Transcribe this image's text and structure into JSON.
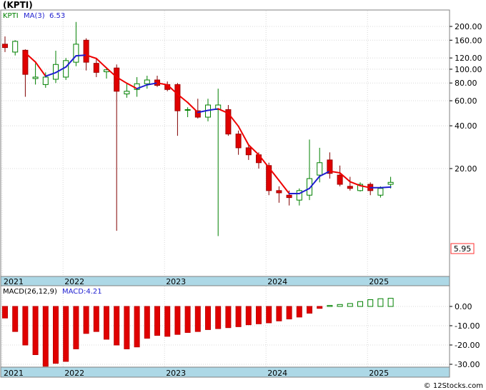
{
  "header": {
    "title": "(KPTI)"
  },
  "price_panel": {
    "ticker": "KPTI",
    "ma_label": "MA(3)",
    "ma_value": "6.53",
    "last_price": "5.95"
  },
  "macd_panel": {
    "label": "MACD(26,12,9)",
    "value_label": "MACD:4.21"
  },
  "credit": "© 12Stocks.com",
  "colors": {
    "up": "#008000",
    "down": "#e00000",
    "ma_up": "#1f1fd0",
    "ma_down": "#ee0000",
    "axis_band": "#add8e6",
    "price_label": "#ff3030"
  },
  "chart_data": [
    {
      "type": "candlestick",
      "scale": "log",
      "interval": "monthly",
      "y_ticks": [
        {
          "value": 200,
          "label": "200.00"
        },
        {
          "value": 160,
          "label": "160.00"
        },
        {
          "value": 120,
          "label": "120.00"
        },
        {
          "value": 100,
          "label": "100.00"
        },
        {
          "value": 80,
          "label": "80.00"
        },
        {
          "value": 60,
          "label": "60.00"
        },
        {
          "value": 40,
          "label": "40.00"
        },
        {
          "value": 20,
          "label": "20.00"
        }
      ],
      "x_ticks": [
        {
          "index": 0,
          "label": "2021"
        },
        {
          "index": 6,
          "label": "2022"
        },
        {
          "index": 16,
          "label": "2023"
        },
        {
          "index": 26,
          "label": "2024"
        },
        {
          "index": 36,
          "label": "2025"
        }
      ],
      "ohlc": [
        {
          "o": 150,
          "h": 170,
          "l": 132,
          "c": 142
        },
        {
          "o": 132,
          "h": 160,
          "l": 125,
          "c": 157
        },
        {
          "o": 136,
          "h": 138,
          "l": 64,
          "c": 92
        },
        {
          "o": 86,
          "h": 110,
          "l": 78,
          "c": 88
        },
        {
          "o": 78,
          "h": 95,
          "l": 74,
          "c": 88
        },
        {
          "o": 85,
          "h": 135,
          "l": 80,
          "c": 108
        },
        {
          "o": 88,
          "h": 120,
          "l": 84,
          "c": 115
        },
        {
          "o": 112,
          "h": 215,
          "l": 105,
          "c": 150
        },
        {
          "o": 160,
          "h": 165,
          "l": 98,
          "c": 112
        },
        {
          "o": 110,
          "h": 120,
          "l": 88,
          "c": 95
        },
        {
          "o": 96,
          "h": 103,
          "l": 86,
          "c": 99
        },
        {
          "o": 102,
          "h": 108,
          "l": 7.3,
          "c": 70
        },
        {
          "o": 67,
          "h": 80,
          "l": 63,
          "c": 70
        },
        {
          "o": 72,
          "h": 88,
          "l": 64,
          "c": 79
        },
        {
          "o": 79,
          "h": 90,
          "l": 73,
          "c": 84
        },
        {
          "o": 84,
          "h": 90,
          "l": 75,
          "c": 77
        },
        {
          "o": 78,
          "h": 82,
          "l": 70,
          "c": 72
        },
        {
          "o": 78,
          "h": 80,
          "l": 34,
          "c": 51
        },
        {
          "o": 52,
          "h": 54,
          "l": 46,
          "c": 52
        },
        {
          "o": 51,
          "h": 62,
          "l": 45,
          "c": 46
        },
        {
          "o": 46,
          "h": 62,
          "l": 43,
          "c": 56
        },
        {
          "o": 52,
          "h": 73,
          "l": 6.7,
          "c": 56
        },
        {
          "o": 52,
          "h": 56,
          "l": 34,
          "c": 35
        },
        {
          "o": 35,
          "h": 37,
          "l": 25,
          "c": 28
        },
        {
          "o": 28,
          "h": 29,
          "l": 23,
          "c": 25
        },
        {
          "o": 25,
          "h": 26,
          "l": 20,
          "c": 22
        },
        {
          "o": 21,
          "h": 22,
          "l": 13,
          "c": 14
        },
        {
          "o": 14,
          "h": 15,
          "l": 11.5,
          "c": 13.5
        },
        {
          "o": 13,
          "h": 14,
          "l": 11,
          "c": 12.5
        },
        {
          "o": 12,
          "h": 14.5,
          "l": 11,
          "c": 14
        },
        {
          "o": 13,
          "h": 32,
          "l": 12,
          "c": 17
        },
        {
          "o": 18,
          "h": 28,
          "l": 16,
          "c": 22
        },
        {
          "o": 23,
          "h": 26,
          "l": 17,
          "c": 18.5
        },
        {
          "o": 18,
          "h": 21,
          "l": 15,
          "c": 15.5
        },
        {
          "o": 15,
          "h": 17.5,
          "l": 14,
          "c": 14.5
        },
        {
          "o": 14,
          "h": 16,
          "l": 13.8,
          "c": 15.5
        },
        {
          "o": 15.5,
          "h": 16,
          "l": 13,
          "c": 14
        },
        {
          "o": 13,
          "h": 15,
          "l": 12.5,
          "c": 14.5
        },
        {
          "o": 15.5,
          "h": 17.5,
          "l": 14.5,
          "c": 16
        }
      ]
    },
    {
      "type": "bar",
      "name": "MACD histogram",
      "y_ticks": [
        {
          "value": 0,
          "label": "0.00"
        },
        {
          "value": -10,
          "label": "-10.00"
        },
        {
          "value": -20,
          "label": "-20.00"
        },
        {
          "value": -30,
          "label": "-30.00"
        }
      ],
      "ylim": [
        -32,
        5
      ],
      "values": [
        -6,
        -13,
        -20,
        -25,
        -31,
        -29.5,
        -28.5,
        -22,
        -14,
        -13,
        -17,
        -20,
        -22,
        -21,
        -16.5,
        -15,
        -15.5,
        -14.5,
        -13.5,
        -13,
        -12,
        -11.5,
        -11,
        -10.5,
        -9.5,
        -9,
        -8.5,
        -7.5,
        -6.5,
        -5.5,
        -3.5,
        -1,
        0.5,
        1,
        1.5,
        2.5,
        3.5,
        4,
        4.21
      ]
    }
  ]
}
